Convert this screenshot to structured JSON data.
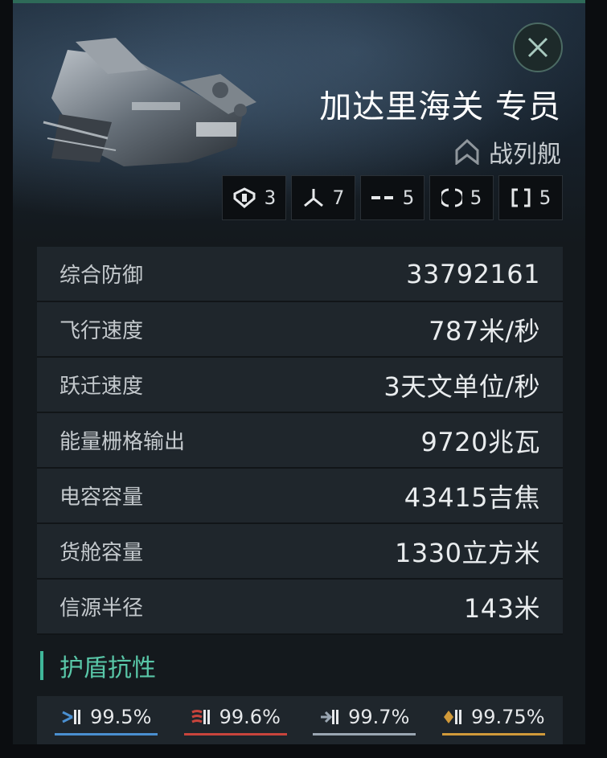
{
  "ship": {
    "name": "加达里海关 专员",
    "class_label": "战列舰"
  },
  "slots": [
    {
      "icon": "high-slot-icon",
      "count": "3"
    },
    {
      "icon": "drone-icon",
      "count": "7"
    },
    {
      "icon": "mid-slot-icon",
      "count": "5"
    },
    {
      "icon": "low-slot-icon",
      "count": "5"
    },
    {
      "icon": "rig-slot-icon",
      "count": "5"
    }
  ],
  "stats": [
    {
      "label": "综合防御",
      "value": "33792161"
    },
    {
      "label": "飞行速度",
      "value": "787米/秒"
    },
    {
      "label": "跃迁速度",
      "value": "3天文单位/秒"
    },
    {
      "label": "能量栅格输出",
      "value": "9720兆瓦"
    },
    {
      "label": "电容容量",
      "value": "43415吉焦"
    },
    {
      "label": "货舱容量",
      "value": "1330立方米"
    },
    {
      "label": "信源半径",
      "value": "143米"
    }
  ],
  "section": {
    "title": "护盾抗性"
  },
  "resists": [
    {
      "icon": "em-damage-icon",
      "value": "99.5%",
      "color": "#4a8fd0"
    },
    {
      "icon": "thermal-damage-icon",
      "value": "99.6%",
      "color": "#c8443c"
    },
    {
      "icon": "kinetic-damage-icon",
      "value": "99.7%",
      "color": "#9aa6b2"
    },
    {
      "icon": "explosive-damage-icon",
      "value": "99.75%",
      "color": "#d19a3a"
    }
  ],
  "colors": {
    "accent": "#3fb79a",
    "panel": "#14191d",
    "row": "#1f262c"
  }
}
